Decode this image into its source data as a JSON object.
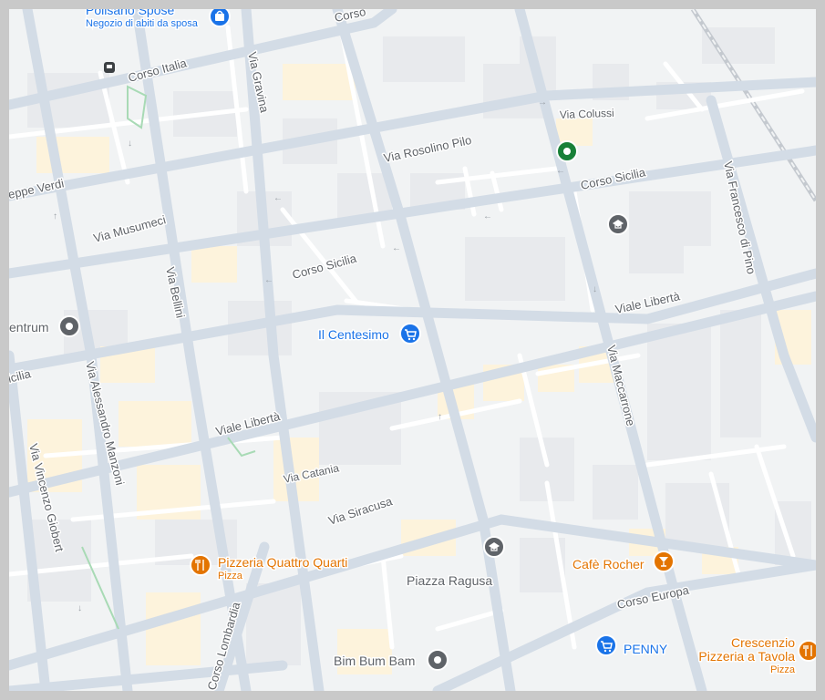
{
  "streets": {
    "corso_italia": "Corso Italia",
    "via_gravina": "Via Gravina",
    "via_rosolino_pilo": "Via Rosolino Pilo",
    "via_colussi": "Via Colussi",
    "corso_sicilia": "Corso Sicilia",
    "via_francesco_di_pino": "Via Francesco di Pino",
    "giuseppe_verdi": "eppe Verdi",
    "via_musumeci": "Via Musumeci",
    "via_bellini": "Via Bellini",
    "viale_liberta": "Viale Libertà",
    "via_alessandro_manzoni": "Via Alessandro Manzoni",
    "via_vincenzo_giobert": "Via Vincenzo Giobert",
    "via_catania": "Via Catania",
    "via_siracusa": "Via Siracusa",
    "via_maccarrone": "Via Maccarrone",
    "corso_europa": "Corso Europa",
    "corso_lombardia": "Corso Lombardia",
    "sicilia_left": "icilia",
    "corso_top": "Corso"
  },
  "places": {
    "polisano": {
      "name": "Polisano Spose",
      "category": "Negozio di abiti da sposa",
      "icon": "shopping-bag-icon",
      "color": "#1a73e8"
    },
    "il_centesimo": {
      "name": "Il Centesimo",
      "icon": "shopping-cart-icon",
      "color": "#1a73e8"
    },
    "centrum": {
      "name": "entrum",
      "icon": "place-marker-icon",
      "color": "#5f6368"
    },
    "pizzeria_quattro": {
      "name": "Pizzeria Quattro Quarti",
      "category": "Pizza",
      "icon": "restaurant-icon",
      "color": "#e37400"
    },
    "piazza_ragusa": {
      "name": "Piazza Ragusa",
      "color": "#5f6368"
    },
    "cafe_rocher": {
      "name": "Cafè Rocher",
      "icon": "cocktail-icon",
      "color": "#e37400"
    },
    "penny": {
      "name": "PENNY",
      "icon": "shopping-cart-icon",
      "color": "#1a73e8"
    },
    "crescenzio": {
      "name_line1": "Crescenzio",
      "name_line2": "Pizzeria a Tavola",
      "category": "Pizza",
      "icon": "restaurant-icon",
      "color": "#e37400"
    },
    "bim_bum_bam": {
      "name": "Bim Bum Bam",
      "icon": "place-marker-icon",
      "color": "#5f6368"
    },
    "school_1": {
      "icon": "school-icon",
      "color": "#5f6368"
    },
    "school_2": {
      "icon": "school-icon",
      "color": "#5f6368"
    },
    "park": {
      "icon": "park-marker-icon",
      "color": "#188038"
    },
    "metro": {
      "icon": "metro-icon",
      "color": "#3c4043"
    }
  },
  "colors": {
    "land": "#f1f3f4",
    "road": "#d3dce6",
    "minor_road": "#ffffff",
    "building": "#e8eaed",
    "building_highlight": "#fdf3dc",
    "park_line": "#a8dab5"
  }
}
